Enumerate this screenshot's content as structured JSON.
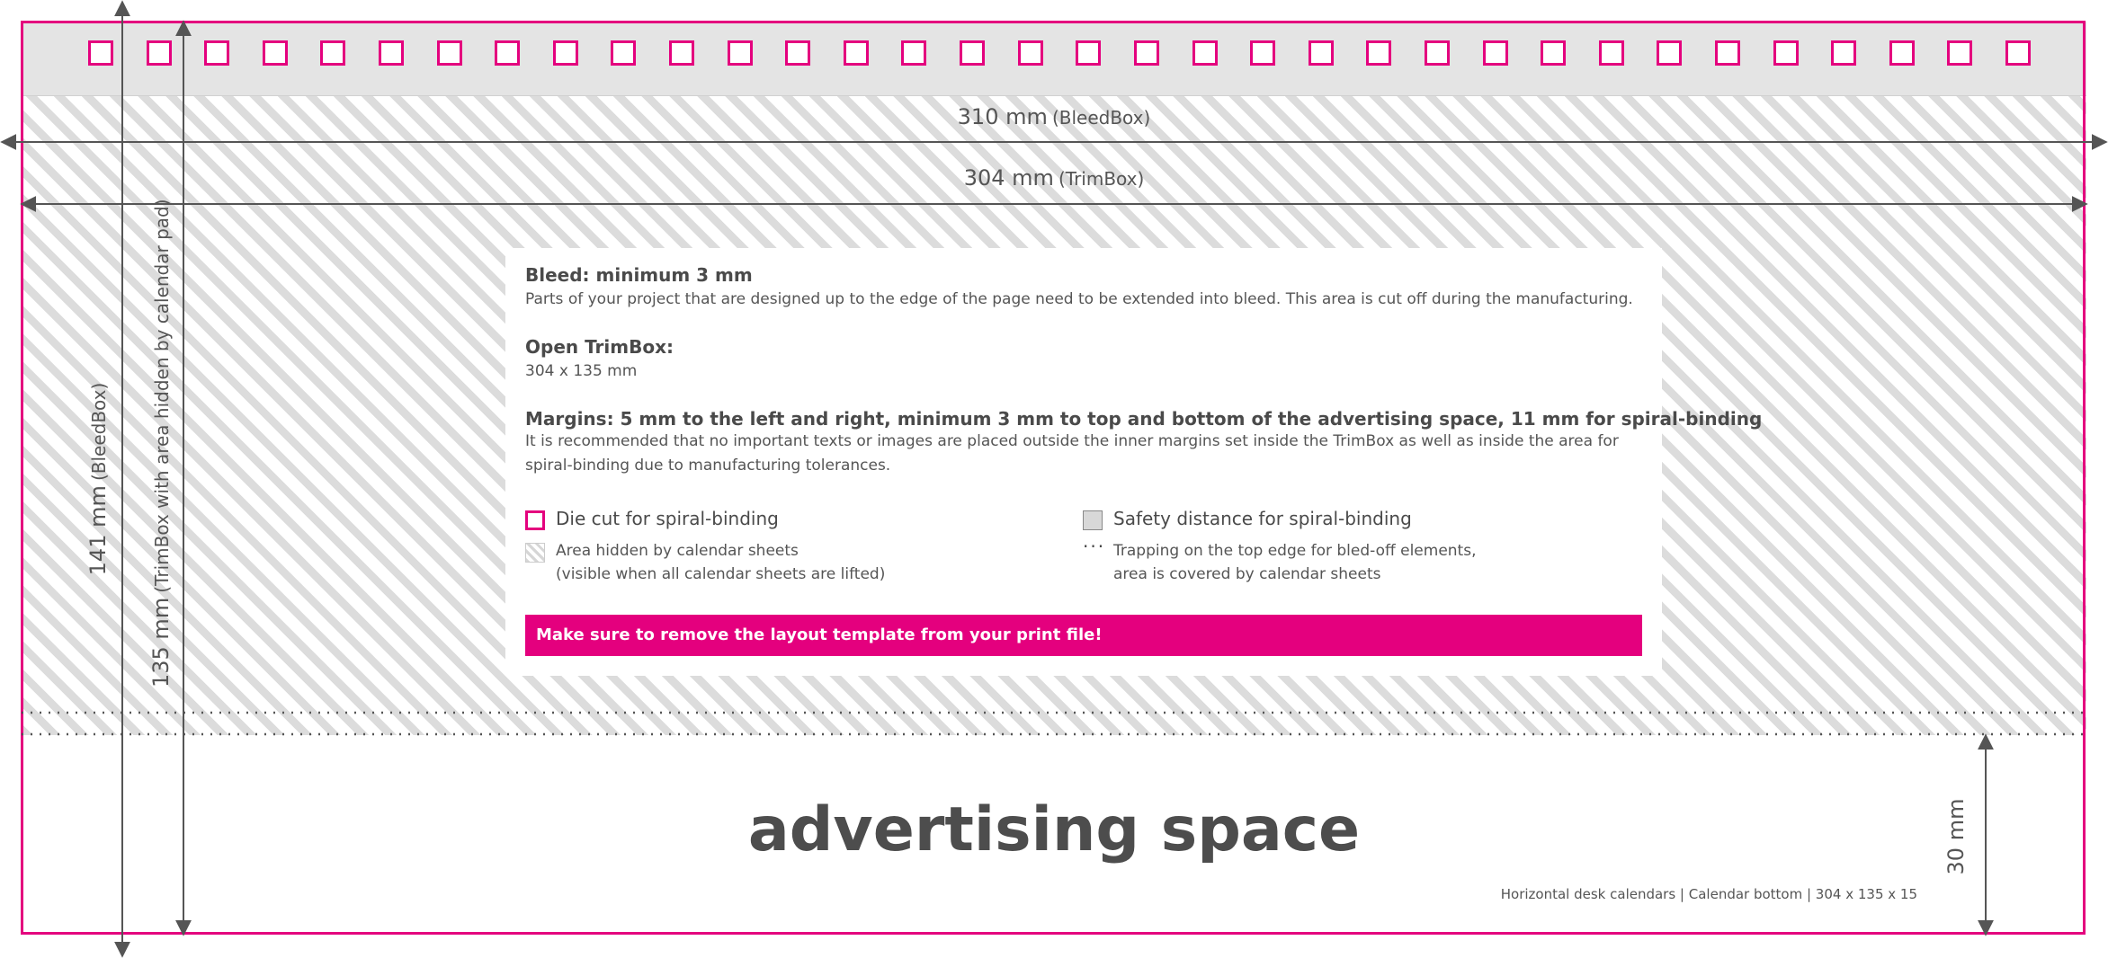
{
  "colors": {
    "die_cut": "#e4007e",
    "warning_bg": "#e4007e",
    "safety_gray": "#e4e4e4",
    "text": "#4a4a4a"
  },
  "die_cut_holes": 34,
  "dimensions": {
    "bleed_width": {
      "value": "310 mm",
      "box": "(BleedBox)"
    },
    "trim_width": {
      "value": "304 mm",
      "box": "(TrimBox)"
    },
    "bleed_height": {
      "value": "141 mm",
      "box": "(BleedBox)"
    },
    "trim_height": {
      "value": "135 mm",
      "box": "(TrimBox with area hidden by calendar pad)"
    },
    "ad_height": {
      "value": "30 mm"
    }
  },
  "info": {
    "bleed_title": "Bleed: minimum 3 mm",
    "bleed_text": "Parts of your project that are designed up to the edge of the page need to be extended into bleed. This area is cut off during the manufacturing.",
    "trim_title": "Open TrimBox:",
    "trim_text": "304 x 135 mm",
    "margins_title": "Margins: 5 mm to the left and right, minimum 3 mm to top and bottom of the advertising space, 11 mm for spiral-binding",
    "margins_text": "It is recommended that no important texts or images are placed outside the inner margins set inside the TrimBox as well as inside the area for spiral-binding due to manufacturing tolerances."
  },
  "legend": {
    "die_cut": "Die cut for spiral-binding",
    "safety": "Safety distance for spiral-binding",
    "hidden_line1": "Area hidden by calendar sheets",
    "hidden_line2": "(visible when all calendar sheets are lifted)",
    "trapping_line1": "Trapping on the top edge for bled-off elements,",
    "trapping_line2": "area is covered by calendar sheets"
  },
  "warning": "Make sure to remove the layout template from your print file!",
  "ad_space_label": "advertising space",
  "footer": "Horizontal desk calendars  |  Calendar bottom  |  304 x 135 x 15"
}
